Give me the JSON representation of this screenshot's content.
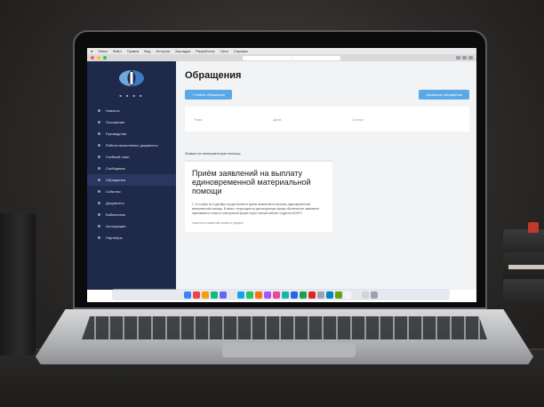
{
  "browser": {
    "menu_items": [
      "Safari",
      "Файл",
      "Правка",
      "Вид",
      "История",
      "Закладки",
      "Разработка",
      "Окно",
      "Справка"
    ],
    "url": "—"
  },
  "sidebar": {
    "items": [
      {
        "label": "Новости"
      },
      {
        "label": "Положение"
      },
      {
        "label": "Руководство"
      },
      {
        "label": "Работы выполнены/ документы"
      },
      {
        "label": "Учебный план"
      },
      {
        "label": "Сообщения"
      },
      {
        "label": "Обращения"
      },
      {
        "label": "События"
      },
      {
        "label": "Документы"
      },
      {
        "label": "Библиотека"
      },
      {
        "label": "Ассоциации"
      },
      {
        "label": "Партнёры"
      }
    ]
  },
  "main": {
    "title": "Обращения",
    "new_request_button": "+ Новое обращение",
    "archive_button": "Архивные обращения",
    "filters": [
      "Тема",
      "Дата",
      "Статус"
    ],
    "section_label": "Заявки на материальную помощь",
    "card": {
      "title": "Приём заявлений на выплату единовременной материальной помощи",
      "text": "С 11 ноября по 5 декабря осуществляется приём заявлений на выплату единовременной материальной помощи. В связи с переходом на дистанционную форму обучения все заявления принимаются только в электронной форме через личный кабинет студента ИСКРО.",
      "more": "Заполнить заявление можно в разделе"
    }
  },
  "colors": {
    "sidebar_bg": "#1f2a4a",
    "accent_button": "#5aa9e6",
    "page_bg": "#f2f3f5"
  }
}
